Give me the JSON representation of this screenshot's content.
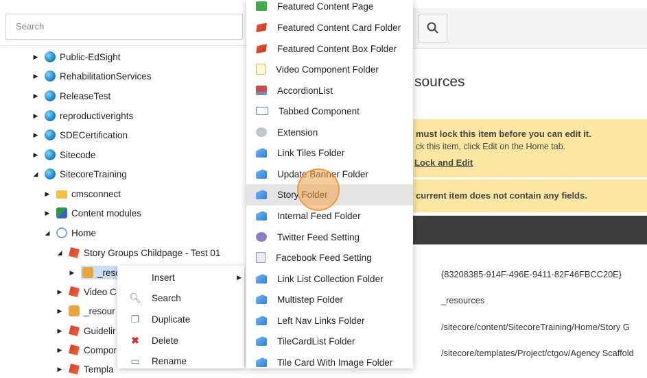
{
  "search": {
    "placeholder": "Search"
  },
  "tree": [
    {
      "label": "Public-EdSight"
    },
    {
      "label": "RehabilitationServices"
    },
    {
      "label": "ReleaseTest"
    },
    {
      "label": "reproductiverights"
    },
    {
      "label": "SDECertification"
    },
    {
      "label": "Sitecode"
    },
    {
      "label": "SitecoreTraining"
    },
    {
      "label": "cmsconnect"
    },
    {
      "label": "Content modules"
    },
    {
      "label": "Home"
    },
    {
      "label": "Story Groups Childpage - Test 01"
    },
    {
      "label": "_reso"
    },
    {
      "label": "Video C"
    },
    {
      "label": "_resour"
    },
    {
      "label": "Guidelir"
    },
    {
      "label": "Compor"
    },
    {
      "label": "Templa"
    }
  ],
  "context_menu": [
    {
      "label": "Insert"
    },
    {
      "label": "Search"
    },
    {
      "label": "Duplicate"
    },
    {
      "label": "Delete"
    },
    {
      "label": "Rename"
    }
  ],
  "insert_menu": [
    {
      "label": "Featured Content Page"
    },
    {
      "label": "Featured Content Card Folder"
    },
    {
      "label": "Featured Content Box Folder"
    },
    {
      "label": "Video Component Folder"
    },
    {
      "label": "AccordionList"
    },
    {
      "label": "Tabbed Component"
    },
    {
      "label": "Extension"
    },
    {
      "label": "Link Tiles Folder"
    },
    {
      "label": "Update Banner Folder"
    },
    {
      "label": "Story Folder"
    },
    {
      "label": "Internal Feed Folder"
    },
    {
      "label": "Twitter Feed Setting"
    },
    {
      "label": "Facebook Feed Setting"
    },
    {
      "label": "Link List Collection Folder"
    },
    {
      "label": "Multistep Folder"
    },
    {
      "label": "Left Nav Links Folder"
    },
    {
      "label": "TileCardList Folder"
    },
    {
      "label": "Tile Card With Image Folder"
    }
  ],
  "content": {
    "heading": "sources",
    "warning_title": "must lock this item before you can edit it.",
    "warning_sub": "ck this item, click Edit on the Home tab.",
    "warning_link": "Lock and Edit",
    "info": "current item does not contain any fields.",
    "fields": [
      "{83208385-914F-496E-9411-82F46FBCC20E}",
      "_resources",
      "/sitecore/content/SitecoreTraining/Home/Story G",
      "/sitecore/templates/Project/ctgov/Agency Scaffold"
    ]
  },
  "colors": {
    "warning_bg": "#fbe7a2",
    "dark_bar": "#3d3d3d",
    "cursor": "#f4a248"
  }
}
